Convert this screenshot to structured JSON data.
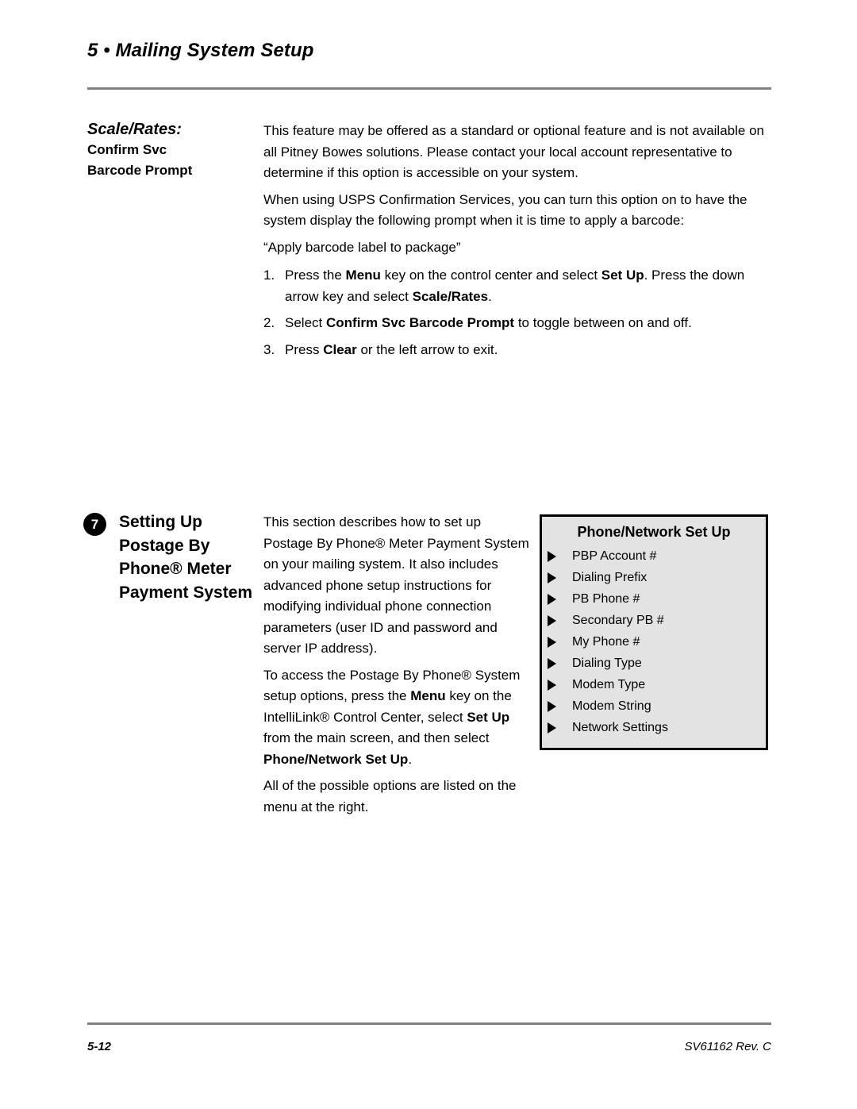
{
  "header": {
    "chapter_number": "5",
    "bullet": "•",
    "chapter_title": "Mailing System Setup",
    "full_text": "5 • Mailing System Setup"
  },
  "topic_scale_rates": {
    "label_lead": "Scale/Rates:",
    "label_line2": "Confirm Svc",
    "label_line3": "Barcode Prompt",
    "paragraph_1": "This feature may be offered as a standard or optional feature and is not available on all Pitney Bowes solutions. Please contact your local account representative to determine if this option is accessible on your system.",
    "paragraph_2": "When using USPS Confirmation Services, you can turn this option on to have the system display the following prompt when it is time to apply a barcode:",
    "paragraph_3": "“Apply barcode label to package”",
    "steps": [
      {
        "number": "1.",
        "parts": [
          {
            "text": "Press the ",
            "bold": false
          },
          {
            "text": "Menu",
            "bold": true
          },
          {
            "text": " key on the control center and select ",
            "bold": false
          },
          {
            "text": "Set Up",
            "bold": true
          },
          {
            "text": ". Press the down arrow key and select ",
            "bold": false
          },
          {
            "text": "Scale/Rates",
            "bold": true
          },
          {
            "text": ".",
            "bold": false
          }
        ]
      },
      {
        "number": "2.",
        "parts": [
          {
            "text": "Select ",
            "bold": false
          },
          {
            "text": "Confirm Svc Barcode Prompt",
            "bold": true
          },
          {
            "text": " to toggle between on and off.",
            "bold": false
          }
        ]
      },
      {
        "number": "3.",
        "parts": [
          {
            "text": "Press ",
            "bold": false
          },
          {
            "text": "Clear",
            "bold": true
          },
          {
            "text": " or the left arrow to exit.",
            "bold": false
          }
        ]
      }
    ]
  },
  "section_seven": {
    "badge_number": "7",
    "title": "Setting Up Postage By Phone® Meter Payment System",
    "paragraph_1": "This section describes how to set up Postage By Phone® Meter Payment System on your mailing system. It also includes advanced phone setup instructions for modifying individual phone connection parameters (user ID and password and server IP address).",
    "paragraph_2_parts": [
      {
        "text": "To access the Postage By Phone® System setup options, press the ",
        "bold": false
      },
      {
        "text": "Menu",
        "bold": true
      },
      {
        "text": " key on the IntelliLink® Control Center, select ",
        "bold": false
      },
      {
        "text": "Set Up",
        "bold": true
      },
      {
        "text": " from the main screen, and then select ",
        "bold": false
      },
      {
        "text": "Phone/Network Set Up",
        "bold": true
      },
      {
        "text": ".",
        "bold": false
      }
    ],
    "paragraph_3": "All of the possible options are listed on the menu at the right."
  },
  "menu_panel": {
    "title": "Phone/Network Set Up",
    "background_color": "#e3e3e3",
    "border_color": "#000000",
    "items": [
      "PBP Account #",
      "Dialing Prefix",
      "PB Phone #",
      "Secondary PB #",
      "My Phone #",
      "Dialing Type",
      "Modem Type",
      "Modem String",
      "Network Settings"
    ]
  },
  "footer": {
    "page_number": "5-12",
    "document_id": "SV61162 Rev. C",
    "rule_color": "#808080"
  }
}
